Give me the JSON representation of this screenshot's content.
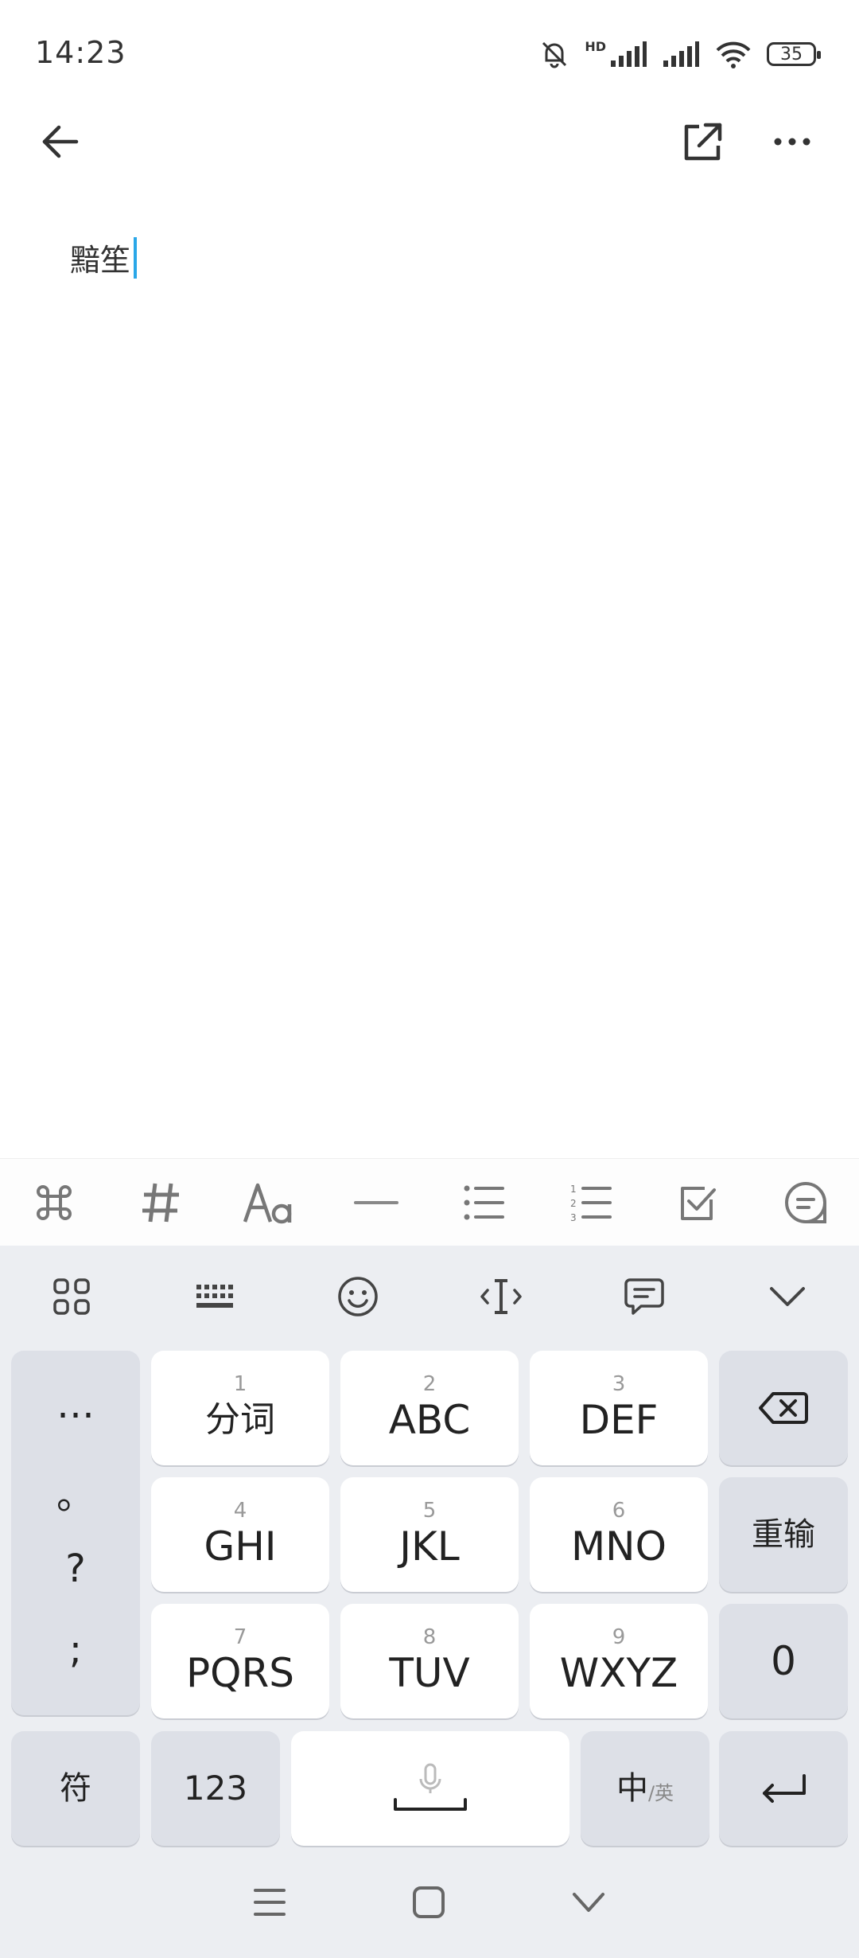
{
  "status_bar": {
    "time": "14:23",
    "network_label": "HD",
    "battery": "35"
  },
  "top_bar": {
    "back_icon": "arrow-left-icon",
    "share_icon": "open-external-icon",
    "more_icon": "more-horizontal-icon"
  },
  "editor": {
    "text": "黯笙"
  },
  "format_toolbar": {
    "items": [
      "command-icon",
      "hash-icon",
      "text-format-icon",
      "divider-icon",
      "bullet-list-icon",
      "numbered-list-icon",
      "checkbox-icon",
      "comment-icon"
    ]
  },
  "keyboard": {
    "toolbar": [
      "grid-menu-icon",
      "keyboard-icon",
      "emoji-icon",
      "cursor-icon",
      "clipboard-icon",
      "collapse-icon"
    ],
    "symbols": [
      "…",
      "。",
      "?",
      ";"
    ],
    "keys": [
      {
        "num": "1",
        "label": "分词"
      },
      {
        "num": "2",
        "label": "ABC"
      },
      {
        "num": "3",
        "label": "DEF"
      },
      {
        "num": "4",
        "label": "GHI"
      },
      {
        "num": "5",
        "label": "JKL"
      },
      {
        "num": "6",
        "label": "MNO"
      },
      {
        "num": "7",
        "label": "PQRS"
      },
      {
        "num": "8",
        "label": "TUV"
      },
      {
        "num": "9",
        "label": "WXYZ"
      }
    ],
    "reset_label": "重输",
    "zero_label": "0",
    "symbol_key": "符",
    "num_key": "123",
    "lang_main": "中",
    "lang_sub": "/英"
  },
  "nav_bar": {
    "icons": [
      "menu-icon",
      "home-icon",
      "back-chevron-icon"
    ]
  }
}
